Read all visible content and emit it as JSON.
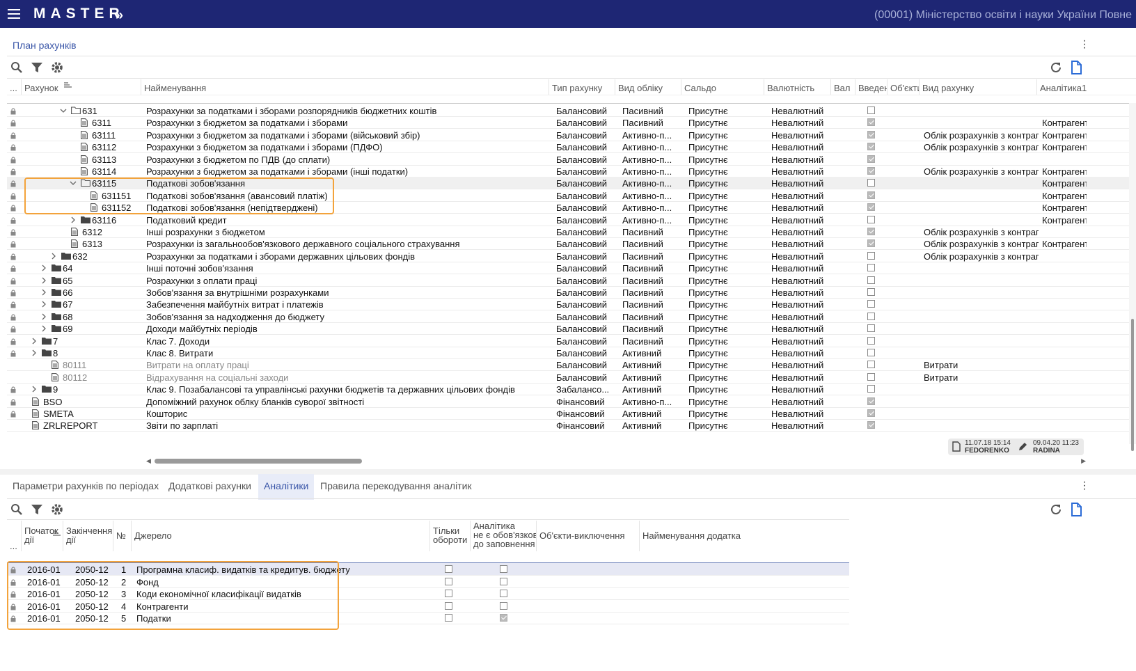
{
  "app": {
    "logo": "MASTER",
    "logo_chevron": "»",
    "org": "(00001) Міністерство освіти і науки України Повне",
    "title": "План рахунків"
  },
  "top_cols": {
    "dots": "...",
    "account": "Рахунок",
    "name": "Найменування",
    "type": "Тип рахунку",
    "kind": "Вид обліку",
    "saldo": "Сальдо",
    "curr": "Валютність",
    "val": "Вал",
    "intro": "Введен",
    "obj": "Об'єкти",
    "vr": "Вид рахунку",
    "an": "Аналітика1"
  },
  "rows": [
    {
      "code": "631",
      "name": "Розрахунки за податками і зборами розпорядників бюджетних коштів",
      "type": "Балансовий",
      "kind": "Пасивний",
      "saldo": "Присутнє",
      "curr": "Невалютний",
      "intro": false,
      "vr": "",
      "an": ""
    },
    {
      "code": "6311",
      "name": "Розрахунки з бюджетом за податками і зборами",
      "type": "Балансовий",
      "kind": "Пасивний",
      "saldo": "Присутнє",
      "curr": "Невалютний",
      "intro": true,
      "vr": "",
      "an": "Контрагенти"
    },
    {
      "code": "63111",
      "name": "Розрахунки з бюджетом за податками і зборами (військовий збір)",
      "type": "Балансовий",
      "kind": "Активно-п...",
      "saldo": "Присутнє",
      "curr": "Невалютний",
      "intro": true,
      "vr": "Облік розрахунків з контрагентами",
      "an": "Контрагенти"
    },
    {
      "code": "63112",
      "name": "Розрахунки з бюджетом за податками і зборами (ПДФО)",
      "type": "Балансовий",
      "kind": "Активно-п...",
      "saldo": "Присутнє",
      "curr": "Невалютний",
      "intro": true,
      "vr": "Облік розрахунків з контрагентами",
      "an": "Контрагенти"
    },
    {
      "code": "63113",
      "name": "Розрахунки з бюджетом по ПДВ (до сплати)",
      "type": "Балансовий",
      "kind": "Активно-п...",
      "saldo": "Присутнє",
      "curr": "Невалютний",
      "intro": true,
      "vr": "",
      "an": ""
    },
    {
      "code": "63114",
      "name": "Розрахунки з бюджетом за податками і зборами (інші податки)",
      "type": "Балансовий",
      "kind": "Активно-п...",
      "saldo": "Присутнє",
      "curr": "Невалютний",
      "intro": true,
      "vr": "Облік розрахунків з контрагентами",
      "an": "Контрагенти"
    },
    {
      "code": "63115",
      "name": "Податкові зобов'язання",
      "type": "Балансовий",
      "kind": "Активно-п...",
      "saldo": "Присутнє",
      "curr": "Невалютний",
      "intro": false,
      "vr": "",
      "an": "Контрагенти"
    },
    {
      "code": "631151",
      "name": "Податкові зобов'язання (авансовий платіж)",
      "type": "Балансовий",
      "kind": "Активно-п...",
      "saldo": "Присутнє",
      "curr": "Невалютний",
      "intro": true,
      "vr": "",
      "an": "Контрагенти"
    },
    {
      "code": "631152",
      "name": "Податкові зобов'язання (непідтверджені)",
      "type": "Балансовий",
      "kind": "Активно-п...",
      "saldo": "Присутнє",
      "curr": "Невалютний",
      "intro": true,
      "vr": "",
      "an": "Контрагенти"
    },
    {
      "code": "63116",
      "name": "Податковий кредит",
      "type": "Балансовий",
      "kind": "Активно-п...",
      "saldo": "Присутнє",
      "curr": "Невалютний",
      "intro": false,
      "vr": "",
      "an": "Контрагенти"
    },
    {
      "code": "6312",
      "name": "Інші розрахунки з бюджетом",
      "type": "Балансовий",
      "kind": "Пасивний",
      "saldo": "Присутнє",
      "curr": "Невалютний",
      "intro": true,
      "vr": "Облік розрахунків з контрагентами",
      "an": ""
    },
    {
      "code": "6313",
      "name": "Розрахунки із загальнообов'язкового державного соціального страхування",
      "type": "Балансовий",
      "kind": "Пасивний",
      "saldo": "Присутнє",
      "curr": "Невалютний",
      "intro": true,
      "vr": "Облік розрахунків з контрагентами",
      "an": "Контрагенти"
    },
    {
      "code": "632",
      "name": "Розрахунки за податками і зборами державних цільових фондів",
      "type": "Балансовий",
      "kind": "Пасивний",
      "saldo": "Присутнє",
      "curr": "Невалютний",
      "intro": false,
      "vr": "Облік розрахунків з контрагентами",
      "an": ""
    },
    {
      "code": "64",
      "name": "Інші поточні зобов'язання",
      "type": "Балансовий",
      "kind": "Пасивний",
      "saldo": "Присутнє",
      "curr": "Невалютний",
      "intro": false,
      "vr": "",
      "an": ""
    },
    {
      "code": "65",
      "name": "Розрахунки з оплати праці",
      "type": "Балансовий",
      "kind": "Пасивний",
      "saldo": "Присутнє",
      "curr": "Невалютний",
      "intro": false,
      "vr": "",
      "an": ""
    },
    {
      "code": "66",
      "name": "Зобов'язання за внутрішніми розрахунками",
      "type": "Балансовий",
      "kind": "Пасивний",
      "saldo": "Присутнє",
      "curr": "Невалютний",
      "intro": false,
      "vr": "",
      "an": ""
    },
    {
      "code": "67",
      "name": "Забезпечення майбутніх витрат і платежів",
      "type": "Балансовий",
      "kind": "Пасивний",
      "saldo": "Присутнє",
      "curr": "Невалютний",
      "intro": false,
      "vr": "",
      "an": ""
    },
    {
      "code": "68",
      "name": "Зобов'язання за надходження до бюджету",
      "type": "Балансовий",
      "kind": "Пасивний",
      "saldo": "Присутнє",
      "curr": "Невалютний",
      "intro": false,
      "vr": "",
      "an": ""
    },
    {
      "code": "69",
      "name": "Доходи майбутніх періодів",
      "type": "Балансовий",
      "kind": "Пасивний",
      "saldo": "Присутнє",
      "curr": "Невалютний",
      "intro": false,
      "vr": "",
      "an": ""
    },
    {
      "code": "7",
      "name": "Клас 7. Доходи",
      "type": "Балансовий",
      "kind": "Пасивний",
      "saldo": "Присутнє",
      "curr": "Невалютний",
      "intro": false,
      "vr": "",
      "an": ""
    },
    {
      "code": "8",
      "name": "Клас 8. Витрати",
      "type": "Балансовий",
      "kind": "Активний",
      "saldo": "Присутнє",
      "curr": "Невалютний",
      "intro": false,
      "vr": "",
      "an": ""
    },
    {
      "code": "80111",
      "name": "Витрати на оплату праці",
      "type": "Балансовий",
      "kind": "Активний",
      "saldo": "Присутнє",
      "curr": "Невалютний",
      "intro": false,
      "vr": "Витрати",
      "an": ""
    },
    {
      "code": "80112",
      "name": "Відрахування на соціальні заходи",
      "type": "Балансовий",
      "kind": "Активний",
      "saldo": "Присутнє",
      "curr": "Невалютний",
      "intro": false,
      "vr": "Витрати",
      "an": ""
    },
    {
      "code": "9",
      "name": "Клас 9. Позабалансові та управлінські рахунки бюджетів та державних цільових фондів",
      "type": "Забалансо...",
      "kind": "Активний",
      "saldo": "Присутнє",
      "curr": "Невалютний",
      "intro": false,
      "vr": "",
      "an": ""
    },
    {
      "code": "BSO",
      "name": "Допоміжний рахунок облку бланків суворої звітності",
      "type": "Фінансовий",
      "kind": "Активно-п...",
      "saldo": "Присутнє",
      "curr": "Невалютний",
      "intro": true,
      "vr": "",
      "an": ""
    },
    {
      "code": "SMETA",
      "name": "Кошторис",
      "type": "Фінансовий",
      "kind": "Активний",
      "saldo": "Присутнє",
      "curr": "Невалютний",
      "intro": true,
      "vr": "",
      "an": ""
    },
    {
      "code": "ZRLREPORT",
      "name": "Звіти по зарплаті",
      "type": "Фінансовий",
      "kind": "Активний",
      "saldo": "Присутнє",
      "curr": "Невалютний",
      "intro": true,
      "vr": "",
      "an": ""
    }
  ],
  "stamp": {
    "created": "11.07.18 15:14",
    "creator": "FEDORENKO",
    "edited": "09.04.20 11:23",
    "editor": "RADINA"
  },
  "tabs": [
    "Параметри рахунків по періодах",
    "Додаткові рахунки",
    "Аналітики",
    "Правила перекодування аналітик"
  ],
  "bottom_cols": {
    "dots": "...",
    "start1": "Початок",
    "start2": "дії",
    "end1": "Закінчення",
    "end2": "дії",
    "num": "№",
    "source": "Джерело",
    "only1": "Тільки",
    "only2": "обороти",
    "an1": "Аналітика",
    "an2": "не є обов'язкова",
    "an3": "до заповнення",
    "objex": "Об'єкти-виключення",
    "appname": "Найменування додатка"
  },
  "brows": [
    {
      "start": "2016-01",
      "end": "2050-12",
      "num": "1",
      "source": "Програмна класиф. видатків та кредитув. бюджету",
      "only": false,
      "opt": false
    },
    {
      "start": "2016-01",
      "end": "2050-12",
      "num": "2",
      "source": "Фонд",
      "only": false,
      "opt": false
    },
    {
      "start": "2016-01",
      "end": "2050-12",
      "num": "3",
      "source": "Коди економічної класифікації видатків",
      "only": false,
      "opt": false
    },
    {
      "start": "2016-01",
      "end": "2050-12",
      "num": "4",
      "source": "Контрагенти",
      "only": false,
      "opt": false
    },
    {
      "start": "2016-01",
      "end": "2050-12",
      "num": "5",
      "source": "Податки",
      "only": false,
      "opt": true
    }
  ]
}
